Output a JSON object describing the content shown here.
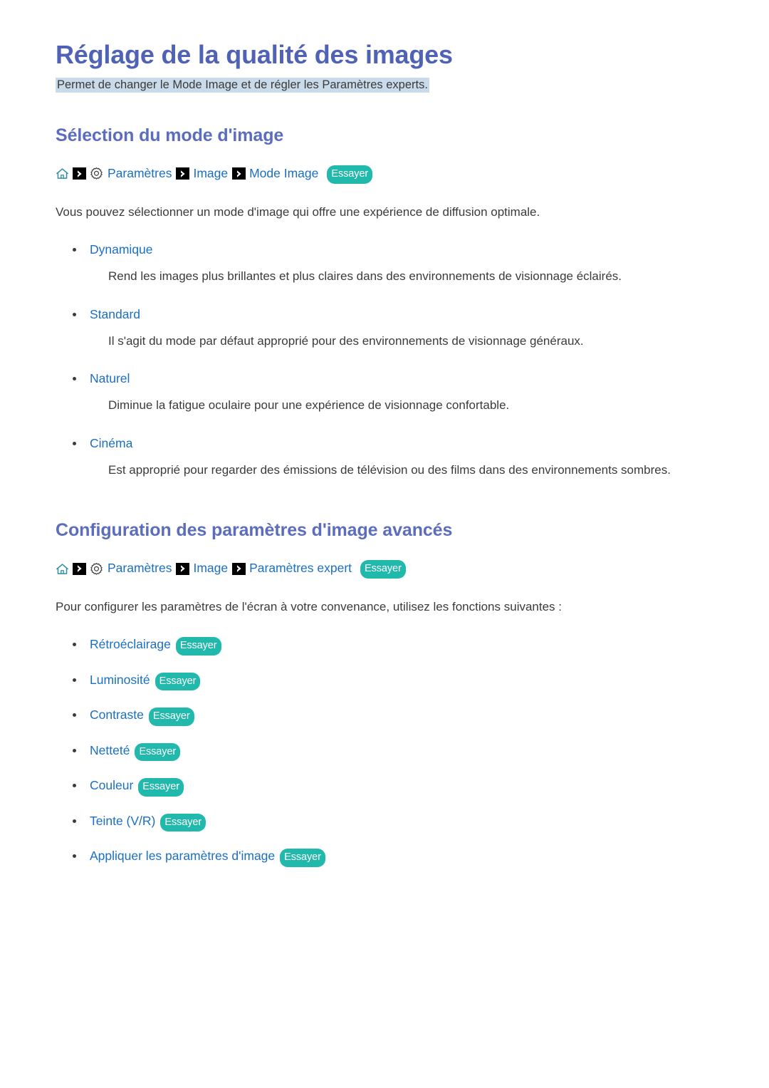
{
  "page": {
    "title": "Réglage de la qualité des images",
    "subtitle": "Permet de changer le Mode Image et de régler les Paramètres experts."
  },
  "colors": {
    "heading": "#5c6dbe",
    "link": "#1a6fc4",
    "badge": "#22b9ad",
    "subtitle_highlight": "#c9dbeb",
    "body_text": "#3b3b3b"
  },
  "sections": [
    {
      "heading": "Sélection du mode d'image",
      "breadcrumb": {
        "home_icon": "home-icon",
        "arrow_icon": "arrow-right-icon",
        "gear_icon": "gear-icon",
        "items": [
          "Paramètres",
          "Image",
          "Mode Image"
        ],
        "badge": "Essayer"
      },
      "intro": "Vous pouvez sélectionner un mode d'image qui offre une expérience de diffusion optimale.",
      "definitions": [
        {
          "term": "Dynamique",
          "description": "Rend les images plus brillantes et plus claires dans des environnements de visionnage éclairés."
        },
        {
          "term": "Standard",
          "description": "Il s'agit du mode par défaut approprié pour des environnements de visionnage généraux."
        },
        {
          "term": "Naturel",
          "description": "Diminue la fatigue oculaire pour une expérience de visionnage confortable."
        },
        {
          "term": "Cinéma",
          "description": "Est approprié pour regarder des émissions de télévision ou des films dans des environnements sombres."
        }
      ]
    },
    {
      "heading": "Configuration des paramètres d'image avancés",
      "breadcrumb": {
        "home_icon": "home-icon",
        "arrow_icon": "arrow-right-icon",
        "gear_icon": "gear-icon",
        "items": [
          "Paramètres",
          "Image",
          "Paramètres expert"
        ],
        "badge": "Essayer"
      },
      "intro": "Pour configurer les paramètres de l'écran à votre convenance, utilisez les fonctions suivantes :",
      "features": [
        {
          "label": "Rétroéclairage",
          "badge": "Essayer"
        },
        {
          "label": "Luminosité",
          "badge": "Essayer"
        },
        {
          "label": "Contraste",
          "badge": "Essayer"
        },
        {
          "label": "Netteté",
          "badge": "Essayer"
        },
        {
          "label": "Couleur",
          "badge": "Essayer"
        },
        {
          "label": "Teinte (V/R)",
          "badge": "Essayer"
        },
        {
          "label": "Appliquer les paramètres d'image",
          "badge": "Essayer"
        }
      ]
    }
  ]
}
